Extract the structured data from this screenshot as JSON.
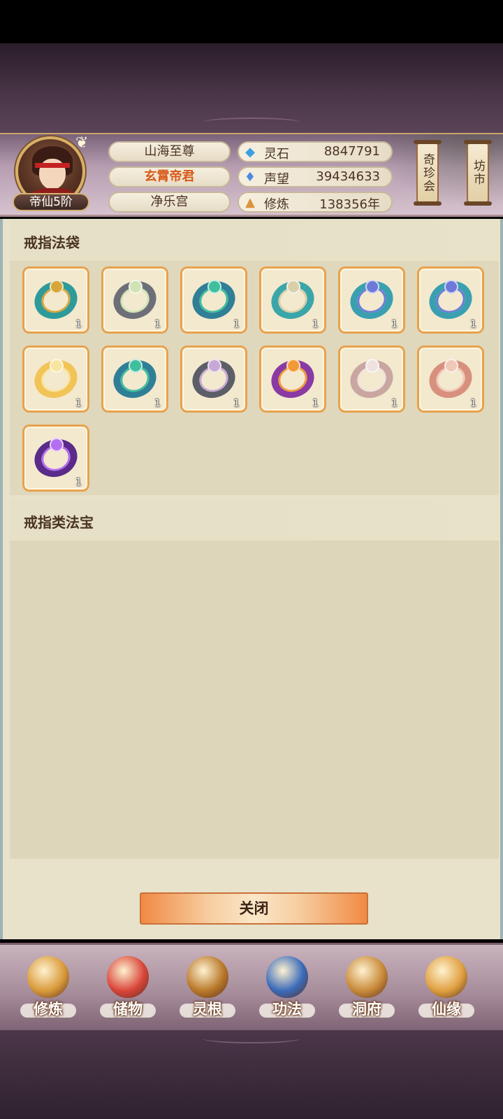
{
  "header": {
    "rank": "帝仙5阶",
    "titles": [
      "山海至尊",
      "玄霄帝君",
      "净乐宫"
    ],
    "active_title_index": 1,
    "stats": [
      {
        "icon": "spirit-stone-icon",
        "label": "灵石",
        "value": "8847791"
      },
      {
        "icon": "reputation-icon",
        "label": "声望",
        "value": "39434633"
      },
      {
        "icon": "cultivation-icon",
        "label": "修炼",
        "value": "138356年"
      }
    ],
    "side_buttons": [
      "奇珍会",
      "坊市"
    ]
  },
  "sections": {
    "bag_title": "戒指法袋",
    "artifact_title": "戒指类法宝"
  },
  "items": [
    {
      "name": "ring-gold-teal",
      "count": "1",
      "colors": [
        "#2e9a9a",
        "#d7a63b"
      ]
    },
    {
      "name": "ring-gray-pearl",
      "count": "1",
      "colors": [
        "#6d6f78",
        "#cfe3b5"
      ]
    },
    {
      "name": "ring-teal-band",
      "count": "1",
      "colors": [
        "#2f7f96",
        "#3fbf9e"
      ]
    },
    {
      "name": "ring-silver-cyan",
      "count": "1",
      "colors": [
        "#3aa6aa",
        "#d9d0aa"
      ]
    },
    {
      "name": "ring-teal-blue-gem",
      "count": "1",
      "colors": [
        "#3aa0b0",
        "#6e7ad9"
      ]
    },
    {
      "name": "ring-teal-blue-gem-2",
      "count": "1",
      "colors": [
        "#3aa0b0",
        "#6e7ad9"
      ]
    },
    {
      "name": "ring-gold",
      "count": "1",
      "colors": [
        "#f2c457",
        "#f7e5a1"
      ]
    },
    {
      "name": "ring-teal-band-2",
      "count": "1",
      "colors": [
        "#2f7f96",
        "#3fbf9e"
      ]
    },
    {
      "name": "ring-gray-purple-pearl",
      "count": "1",
      "colors": [
        "#5c5e68",
        "#c8a8d6"
      ]
    },
    {
      "name": "ring-purple-orange",
      "count": "1",
      "colors": [
        "#8a3aa3",
        "#f29a38"
      ]
    },
    {
      "name": "ring-rose-silver",
      "count": "1",
      "colors": [
        "#c9a6a0",
        "#efe2de"
      ]
    },
    {
      "name": "ring-rose-copper",
      "count": "1",
      "colors": [
        "#d8907e",
        "#f0c8b8"
      ]
    },
    {
      "name": "ring-purple-dark",
      "count": "1",
      "colors": [
        "#5a2b8a",
        "#b46ef0"
      ]
    }
  ],
  "close_button": "关闭",
  "nav": [
    {
      "icon": "cultivate-icon",
      "label": "修炼",
      "color": "#d99a3a"
    },
    {
      "icon": "storage-bag-icon",
      "label": "储物",
      "color": "#d9453a"
    },
    {
      "icon": "spirit-root-icon",
      "label": "灵根",
      "color": "#b9782a"
    },
    {
      "icon": "technique-book-icon",
      "label": "功法",
      "color": "#3a6ab9"
    },
    {
      "icon": "cave-mansion-icon",
      "label": "洞府",
      "color": "#c98a3a"
    },
    {
      "icon": "destiny-gourd-icon",
      "label": "仙缘",
      "color": "#e0a040"
    }
  ]
}
